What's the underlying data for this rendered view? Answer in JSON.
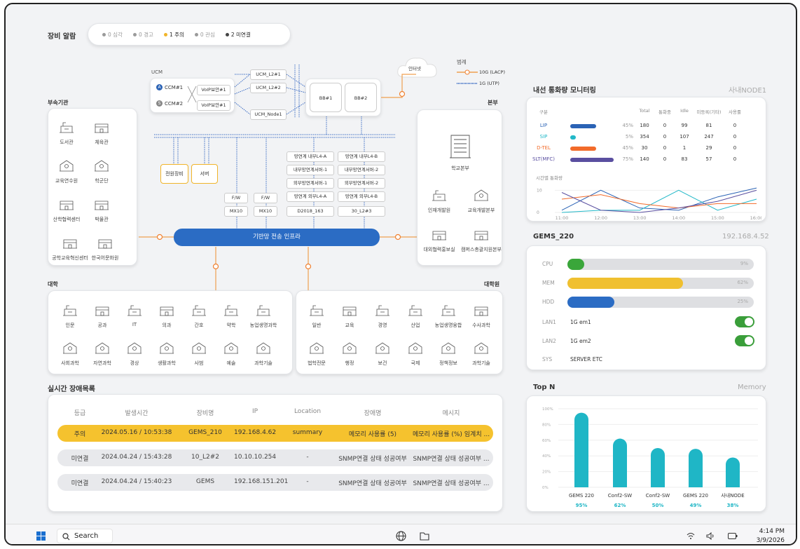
{
  "alarm": {
    "title": "장비 알람",
    "items": [
      {
        "label": "0 심각",
        "color": "#9a9a9a"
      },
      {
        "label": "0 경고",
        "color": "#9a9a9a"
      },
      {
        "label": "1 주의",
        "color": "#f0b429",
        "active": true
      },
      {
        "label": "0 관심",
        "color": "#9a9a9a"
      },
      {
        "label": "2 미연결",
        "color": "#444444",
        "active": true
      }
    ]
  },
  "net": {
    "ucm": "UCM",
    "ccm1": "CCM#1",
    "ccm2": "CCM#2",
    "badge_a": "A",
    "badge_s": "S",
    "voip1": "VoIP보안#1",
    "voip2": "VoIP보안#1",
    "ucm_l2_1": "UCM_L2#1",
    "ucm_l2_2": "UCM_L2#2",
    "ucm_node1": "UCM_Node1",
    "bb1": "BB#1",
    "bb2": "BB#2",
    "internet": "인터넷",
    "legend_title": "범례",
    "legend_10g": "10G (LACP)",
    "legend_1g": "1G (UTP)",
    "power": "전원장비",
    "server": "서버",
    "fw1": "F/W",
    "fw2": "F/W",
    "mx1": "MX10",
    "mx2": "MX10",
    "col1": [
      "망연계 내부L4-A",
      "내부망연계서버-1",
      "외부망연계서버-1",
      "망연계 외부L4-A",
      "D2018_163"
    ],
    "col2": [
      "망연계 내부L4-B",
      "내부망연계서버-2",
      "외부망연계서버-2",
      "망연계 외부L4-B",
      "30_L2#3"
    ],
    "backbone": "기반망 전송 인프라"
  },
  "affiliated": {
    "title": "부속기관",
    "items": [
      "도서관",
      "체육관",
      "교육연수원",
      "학군단",
      "산학협력센터",
      "박물관",
      "공학교육혁신센터",
      "한국어문화원"
    ]
  },
  "hq": {
    "title": "본부",
    "main": "학교본부",
    "items": [
      "인재개발원",
      "교육개발본부",
      "대외협력홍보실",
      "캠퍼스총괄지원본부"
    ]
  },
  "univ": {
    "title": "대학",
    "row1": [
      "인문",
      "공과",
      "IT",
      "의과",
      "간호",
      "약학",
      "농업생명과학"
    ],
    "row2": [
      "사회과학",
      "자연과학",
      "경상",
      "생활과학",
      "사범",
      "예술",
      "과학기술"
    ]
  },
  "grad": {
    "title": "대학원",
    "row1": [
      "일반",
      "교육",
      "경영",
      "산업",
      "농업생명융합",
      "수사과학"
    ],
    "row2": [
      "법학전문",
      "행정",
      "보건",
      "국제",
      "정책정보",
      "과학기술"
    ]
  },
  "faults": {
    "title": "실시간 장애목록",
    "headers": [
      "등급",
      "발생시간",
      "장비명",
      "IP",
      "Location",
      "장애명",
      "메시지"
    ],
    "rows": [
      {
        "grade": "주의",
        "time": "2024.05.16 / 10:53:38",
        "device": "GEMS_210",
        "ip": "192.168.4.62",
        "loc": "summary",
        "name": "메모리 사용률 (5)",
        "msg": "메모리 사용률 (%) 임계치 ..."
      },
      {
        "grade": "미연결",
        "time": "2024.04.24 / 15:43:28",
        "device": "10_L2#2",
        "ip": "10.10.10.254",
        "loc": "-",
        "name": "SNMP연결 상태 성공여부",
        "msg": "SNMP연결 상태 성공여부 ..."
      },
      {
        "grade": "미연결",
        "time": "2024.04.24 / 15:40:23",
        "device": "GEMS",
        "ip": "192.168.151.201",
        "loc": "-",
        "name": "SNMP연결 상태 성공여부",
        "msg": "SNMP연결 상태 성공여부 ..."
      }
    ]
  },
  "traffic": {
    "title": "내선 통화량 모니터링",
    "node": "사내NODE1",
    "headers": [
      "구분",
      "Total",
      "통화중",
      "Idle",
      "미등록(기타)",
      "사용률"
    ],
    "rows": [
      {
        "name": "LIP",
        "color": "#2b63b5",
        "pct": "45%",
        "total": "180",
        "busy": "0",
        "idle": "99",
        "unreg": "81",
        "use": "0",
        "w": 45
      },
      {
        "name": "SIP",
        "color": "#22b8c8",
        "pct": "5%",
        "total": "354",
        "busy": "0",
        "idle": "107",
        "unreg": "247",
        "use": "0",
        "w": 5
      },
      {
        "name": "D-TEL",
        "color": "#f26b2a",
        "pct": "45%",
        "total": "30",
        "busy": "0",
        "idle": "1",
        "unreg": "29",
        "use": "0",
        "w": 45
      },
      {
        "name": "SLT(MFC)",
        "color": "#5a4fa0",
        "pct": "75%",
        "total": "140",
        "busy": "0",
        "idle": "83",
        "unreg": "57",
        "use": "0",
        "w": 75
      }
    ],
    "chart_label": "시간별 통화량",
    "chart_data": {
      "type": "line",
      "x": [
        "11:00",
        "12:00",
        "13:00",
        "14:00",
        "15:00",
        "16:00"
      ],
      "yticks": [
        "10",
        "0"
      ],
      "ylim": [
        0,
        12
      ],
      "series": [
        {
          "color": "#2b63b5",
          "values": [
            1,
            10,
            2,
            1,
            7,
            11
          ]
        },
        {
          "color": "#22b8c8",
          "values": [
            0,
            1,
            1,
            10,
            1,
            6
          ]
        },
        {
          "color": "#f26b2a",
          "values": [
            6,
            8,
            4,
            2,
            4,
            4
          ]
        },
        {
          "color": "#5a4fa0",
          "values": [
            9,
            1,
            0,
            2,
            5,
            10
          ]
        }
      ]
    }
  },
  "gems": {
    "title": "GEMS_220",
    "ip": "192.168.4.52",
    "bars": [
      {
        "label": "CPU",
        "value": 9,
        "text": "9%",
        "color": "#3aa63a"
      },
      {
        "label": "MEM",
        "value": 62,
        "text": "62%",
        "color": "#f0c030"
      },
      {
        "label": "HDD",
        "value": 25,
        "text": "25%",
        "color": "#2b6cc4"
      }
    ],
    "lan1_label": "LAN1",
    "lan1_value": "1G em1",
    "lan2_label": "LAN2",
    "lan2_value": "1G em2",
    "sys_label": "SYS",
    "sys_value": "SERVER ETC"
  },
  "topn": {
    "title": "Top N",
    "metric": "Memory",
    "chart_data": {
      "type": "bar",
      "categories": [
        "GEMS 220",
        "Conf2-SW",
        "Conf2-SW",
        "GEMS 220",
        "사내NODE"
      ],
      "values": [
        95,
        62,
        50,
        49,
        38
      ],
      "value_labels": [
        "95%",
        "62%",
        "50%",
        "49%",
        "38%"
      ],
      "yticks": [
        "100%",
        "80%",
        "60%",
        "40%",
        "20%",
        "0%"
      ],
      "ylim": [
        0,
        100
      ],
      "color": "#1fb6c6"
    }
  },
  "taskbar": {
    "search": "Search",
    "time": "4:14 PM",
    "date": "3/9/2026"
  }
}
